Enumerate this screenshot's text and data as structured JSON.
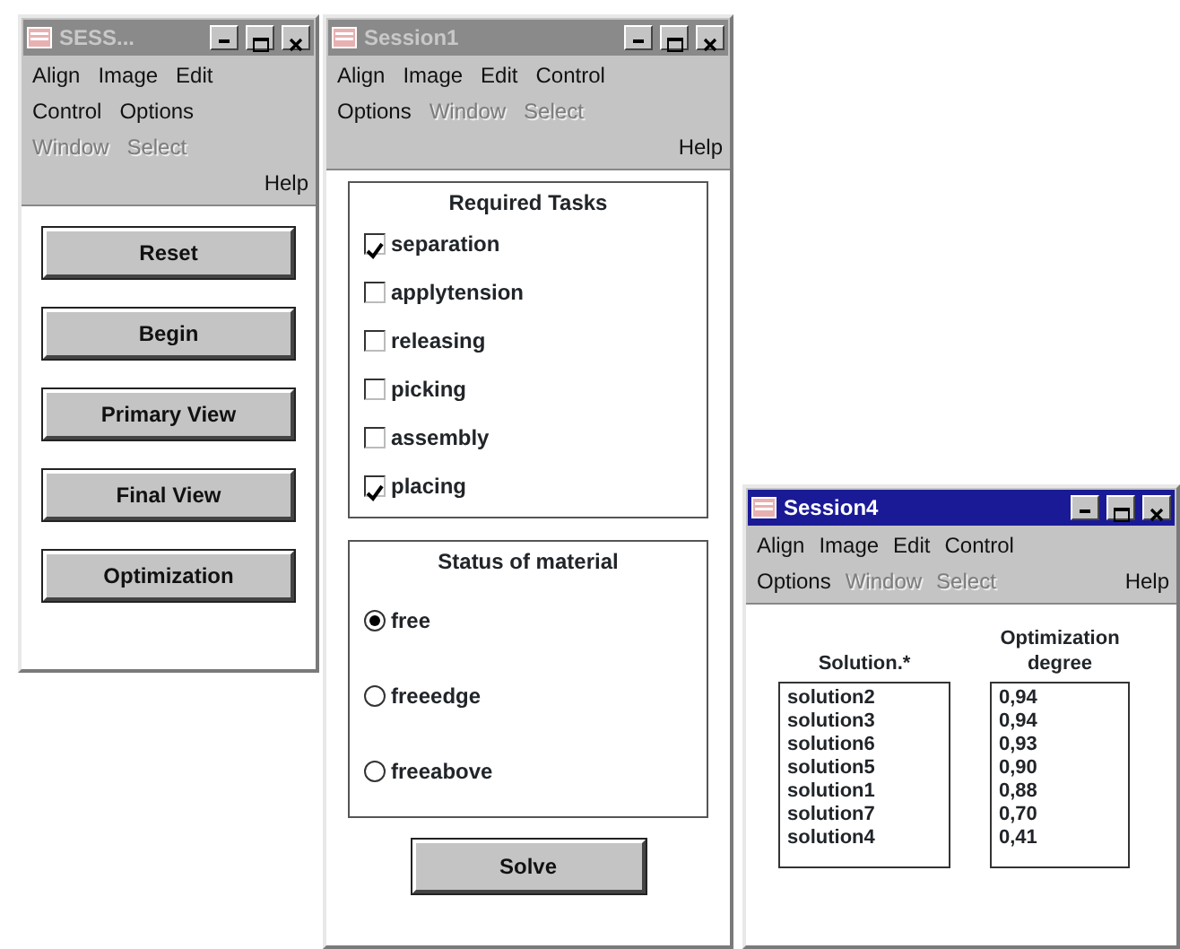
{
  "windows": [
    {
      "title": "SESS...",
      "active": false,
      "menu_rows": [
        [
          {
            "label": "Align",
            "disabled": false,
            "kind": "menu"
          },
          {
            "label": "Image",
            "disabled": false,
            "kind": "menu"
          },
          {
            "label": "Edit",
            "disabled": false,
            "kind": "menu"
          }
        ],
        [
          {
            "label": "Control",
            "disabled": false,
            "kind": "menu"
          },
          {
            "label": "Options",
            "disabled": false,
            "kind": "menu"
          }
        ],
        [
          {
            "label": "Window",
            "disabled": true,
            "kind": "menu"
          },
          {
            "label": "Select",
            "disabled": true,
            "kind": "menu"
          }
        ],
        [
          {
            "label": "Help",
            "disabled": false,
            "kind": "help"
          }
        ]
      ],
      "buttons": [
        "Reset",
        "Begin",
        "Primary View",
        "Final View",
        "Optimization"
      ]
    },
    {
      "title": "Session1",
      "active": false,
      "menu_rows": [
        [
          {
            "label": "Align",
            "disabled": false,
            "kind": "menu"
          },
          {
            "label": "Image",
            "disabled": false,
            "kind": "menu"
          },
          {
            "label": "Edit",
            "disabled": false,
            "kind": "menu"
          },
          {
            "label": "Control",
            "disabled": false,
            "kind": "menu"
          }
        ],
        [
          {
            "label": "Options",
            "disabled": false,
            "kind": "menu"
          },
          {
            "label": "Window",
            "disabled": true,
            "kind": "menu"
          },
          {
            "label": "Select",
            "disabled": true,
            "kind": "menu"
          }
        ],
        [
          {
            "label": "Help",
            "disabled": false,
            "kind": "help"
          }
        ]
      ],
      "tasks": {
        "title": "Required Tasks",
        "items": [
          {
            "label": "separation",
            "checked": true
          },
          {
            "label": "applytension",
            "checked": false
          },
          {
            "label": "releasing",
            "checked": false
          },
          {
            "label": "picking",
            "checked": false
          },
          {
            "label": "assembly",
            "checked": false
          },
          {
            "label": "placing",
            "checked": true
          }
        ]
      },
      "material": {
        "title": "Status of material",
        "items": [
          {
            "label": "free",
            "selected": true
          },
          {
            "label": "freeedge",
            "selected": false
          },
          {
            "label": "freeabove",
            "selected": false
          }
        ]
      },
      "buttons": [
        "Solve"
      ]
    },
    {
      "title": "Session4",
      "active": true,
      "menu_rows": [
        [
          {
            "label": "Align",
            "disabled": false,
            "kind": "menu"
          },
          {
            "label": "Image",
            "disabled": false,
            "kind": "menu"
          },
          {
            "label": "Edit",
            "disabled": false,
            "kind": "menu"
          },
          {
            "label": "Control",
            "disabled": false,
            "kind": "menu"
          }
        ],
        [
          {
            "label": "Options",
            "disabled": false,
            "kind": "menu"
          },
          {
            "label": "Window",
            "disabled": true,
            "kind": "menu"
          },
          {
            "label": "Select",
            "disabled": true,
            "kind": "menu"
          },
          {
            "label": "Help",
            "disabled": false,
            "kind": "help"
          }
        ]
      ],
      "lists": [
        {
          "heading": "Solution.*",
          "items": [
            "solution2",
            "solution3",
            "solution6",
            "solution5",
            "solution1",
            "solution7",
            "solution4"
          ]
        },
        {
          "heading": "Optimization degree",
          "items": [
            "0,94",
            "0,94",
            "0,93",
            "0,90",
            "0,88",
            "0,70",
            "0,41"
          ]
        }
      ]
    }
  ]
}
